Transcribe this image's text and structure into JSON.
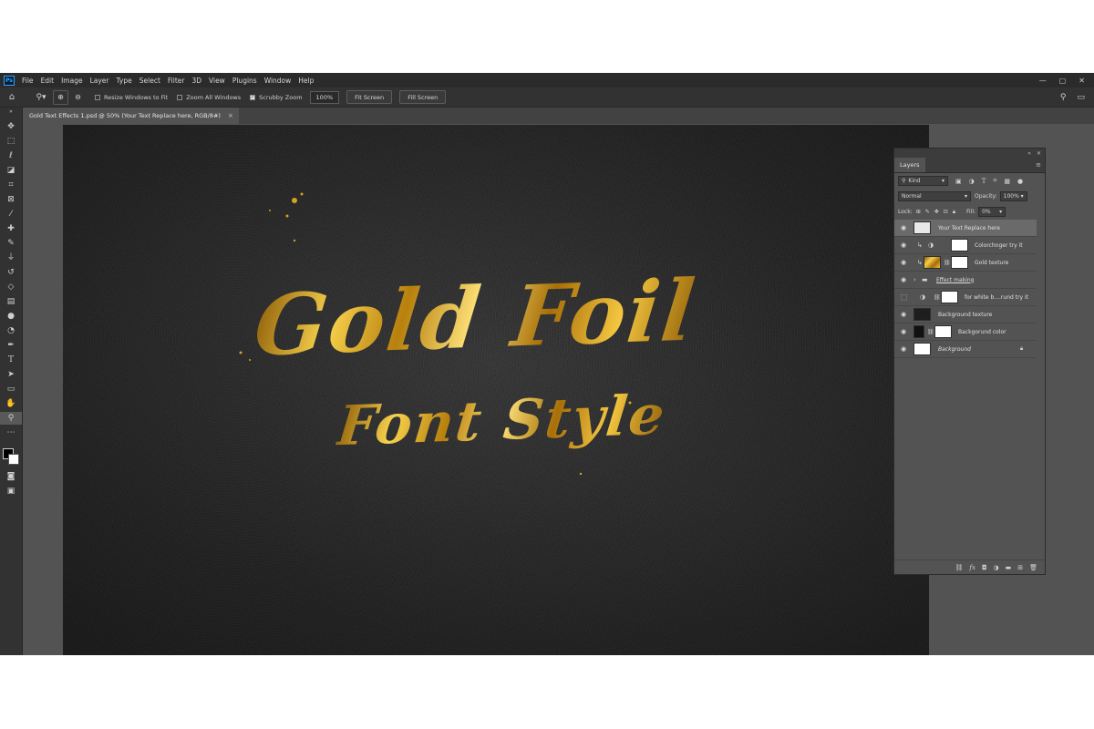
{
  "app": {
    "logo": "Ps"
  },
  "menu": [
    "File",
    "Edit",
    "Image",
    "Layer",
    "Type",
    "Select",
    "Filter",
    "3D",
    "View",
    "Plugins",
    "Window",
    "Help"
  ],
  "window_controls": [
    "—",
    "▢",
    "✕"
  ],
  "options": {
    "resize_windows_to_fit": "Resize Windows to Fit",
    "zoom_all_windows": "Zoom All Windows",
    "scrubby_zoom": "Scrubby Zoom",
    "zoom_value": "100%",
    "fit_screen": "Fit Screen",
    "fill_screen": "Fill Screen"
  },
  "document_tab": {
    "title": "Gold Text Effects 1.psd @ 50% (Your Text Replace here, RGB/8#)",
    "close": "×"
  },
  "canvas_text": {
    "line1": "Gold Foil",
    "line2": "Font Style"
  },
  "layers_panel": {
    "tab": "Layers",
    "filter_kind": "Kind",
    "blend_mode": "Normal",
    "opacity_label": "Opacity:",
    "opacity_value": "100%",
    "lock_label": "Lock:",
    "fill_label": "Fill:",
    "fill_value": "0%",
    "layers": [
      {
        "name": "Your Text Replace here",
        "visible": true
      },
      {
        "name": "Colorchnger try it",
        "visible": true
      },
      {
        "name": "Gold texture",
        "visible": true
      },
      {
        "name": "Effect making",
        "visible": true
      },
      {
        "name": "for white b....rund try it",
        "visible": false
      },
      {
        "name": "Background texture",
        "visible": true
      },
      {
        "name": "Backgorund color",
        "visible": true
      },
      {
        "name": "Background",
        "visible": true
      }
    ]
  },
  "colors": {
    "accent": "#31a8ff",
    "gold": "#e3b12c",
    "canvas": "#222222",
    "app_bg": "#535353"
  }
}
